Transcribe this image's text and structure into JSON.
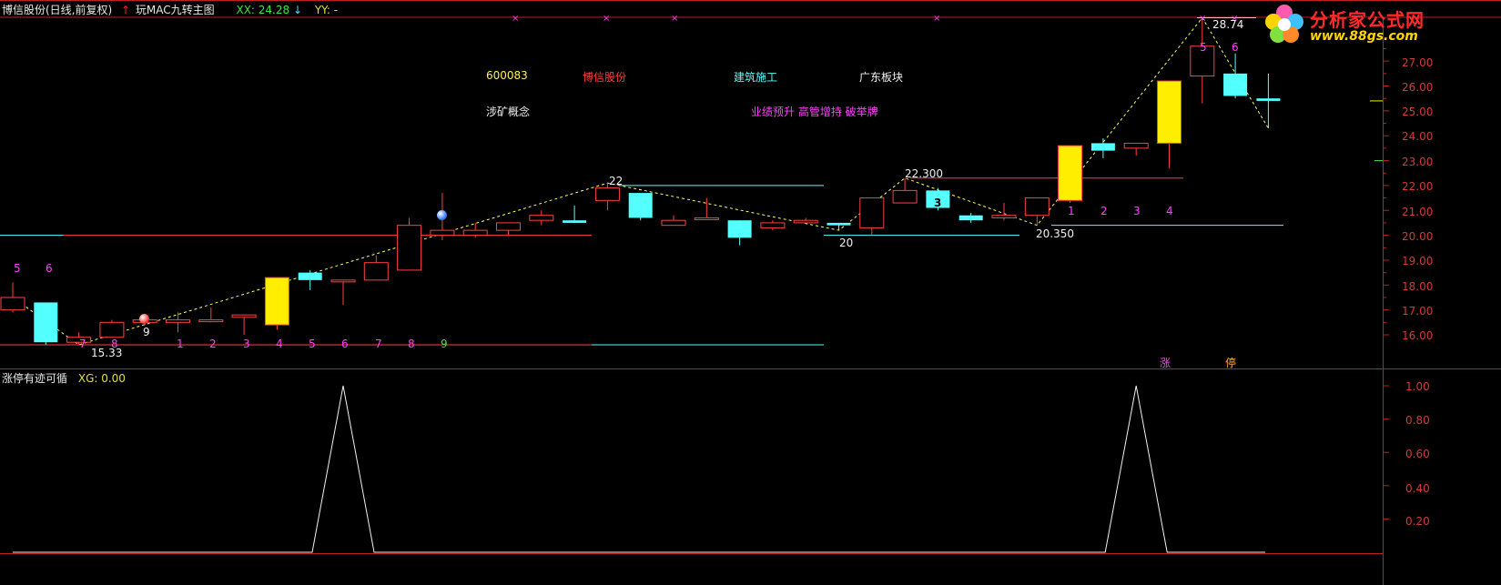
{
  "header": {
    "title": "博信股份(日线,前复权)",
    "indicator_name": "玩MAC九转主图",
    "xx_label": "XX: 24.28",
    "yy_label": "YY: -"
  },
  "sub_header": {
    "indicator_name": "涨停有迹可循",
    "xg_label": "XG: 0.00"
  },
  "logo": {
    "name": "分析家公式网",
    "url": "www.88gs.com"
  },
  "stock_info": {
    "code": "600083",
    "name": "博信股份",
    "industry": "建筑施工",
    "region": "广东板块",
    "concept": "涉矿概念",
    "tags": "业绩预升 高管增持 破举牌"
  },
  "price_axis": [
    "27.00",
    "26.00",
    "25.00",
    "24.00",
    "23.00",
    "22.00",
    "21.00",
    "20.00",
    "19.00",
    "18.00",
    "17.00",
    "16.00"
  ],
  "indicator_axis": [
    "1.00",
    "0.80",
    "0.60",
    "0.40",
    "0.20"
  ],
  "annotations": {
    "high_22": "22",
    "high_22300": "22.300",
    "low_20": "20",
    "low_20350": "20.350",
    "low_1533": "15.33",
    "high_2874": "28.74",
    "zhang": "涨",
    "ting": "停",
    "nine_left": "9",
    "three_mid": "3"
  },
  "count_labels": {
    "top_left": [
      "5",
      "6"
    ],
    "bottom_seq": [
      "7",
      "8",
      "9",
      "1",
      "2",
      "3",
      "4",
      "5",
      "6",
      "7",
      "8",
      "9"
    ],
    "right_seq": [
      "1",
      "2",
      "3",
      "4"
    ],
    "top_right": [
      "5",
      "6"
    ]
  },
  "colors": {
    "up": "#ff4040",
    "down": "#54ffff",
    "yellow": "#ffee00",
    "axis": "#c02020",
    "zigzag": "#ffff66"
  },
  "chart_data": {
    "type": "candlestick",
    "series": [
      {
        "name": "K",
        "ohlc": [
          [
            17.0,
            17.5,
            16.9,
            18.1
          ],
          [
            17.3,
            15.7,
            15.6,
            17.3
          ],
          [
            15.7,
            15.9,
            15.6,
            16.1
          ],
          [
            15.9,
            16.5,
            15.9,
            16.6
          ],
          [
            16.5,
            16.6,
            16.4,
            16.7
          ],
          [
            16.5,
            16.6,
            16.1,
            16.9
          ],
          [
            16.6,
            16.6,
            16.5,
            17.1
          ],
          [
            16.7,
            16.8,
            16.0,
            16.8
          ],
          [
            16.4,
            18.3,
            16.2,
            18.3
          ],
          [
            18.5,
            18.2,
            17.8,
            18.6
          ],
          [
            18.2,
            18.2,
            17.2,
            18.2
          ],
          [
            18.2,
            18.9,
            18.2,
            19.2
          ],
          [
            18.6,
            20.4,
            18.6,
            20.7
          ],
          [
            20.0,
            20.2,
            19.8,
            21.7
          ],
          [
            20.0,
            20.2,
            19.9,
            20.5
          ],
          [
            20.2,
            20.5,
            20.0,
            20.5
          ],
          [
            20.6,
            20.8,
            20.4,
            21.0
          ],
          [
            20.6,
            20.5,
            20.5,
            21.2
          ],
          [
            21.4,
            21.9,
            21.0,
            22.1
          ],
          [
            21.7,
            20.7,
            20.6,
            21.7
          ],
          [
            20.4,
            20.6,
            20.4,
            20.8
          ],
          [
            20.7,
            20.7,
            20.7,
            21.5
          ],
          [
            20.6,
            19.9,
            19.6,
            20.6
          ],
          [
            20.3,
            20.5,
            20.2,
            20.6
          ],
          [
            20.5,
            20.6,
            20.5,
            20.7
          ],
          [
            20.5,
            20.4,
            20.2,
            20.5
          ],
          [
            20.3,
            21.5,
            20.0,
            21.5
          ],
          [
            21.3,
            21.8,
            21.3,
            22.3
          ],
          [
            21.8,
            21.1,
            21.0,
            21.9
          ],
          [
            20.8,
            20.6,
            20.5,
            20.9
          ],
          [
            20.7,
            20.8,
            20.6,
            21.3
          ],
          [
            20.8,
            21.5,
            20.4,
            21.5
          ],
          [
            21.4,
            23.6,
            21.3,
            23.6
          ],
          [
            23.7,
            23.4,
            23.1,
            23.9
          ],
          [
            23.5,
            23.7,
            23.2,
            23.7
          ],
          [
            23.7,
            26.2,
            22.7,
            26.2
          ],
          [
            26.4,
            27.6,
            25.3,
            28.74
          ],
          [
            26.5,
            25.6,
            25.5,
            27.3
          ],
          [
            25.5,
            25.4,
            24.3,
            26.5
          ]
        ]
      }
    ],
    "indicator": {
      "name": "XG",
      "signal_bars": [
        10,
        34
      ]
    },
    "ylim": [
      15.5,
      28.9
    ]
  }
}
